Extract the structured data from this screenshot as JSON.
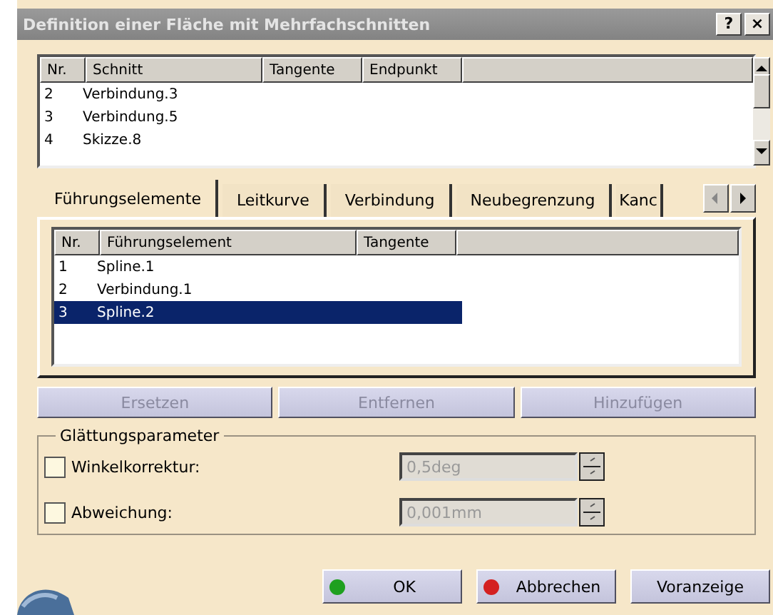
{
  "window": {
    "title": "Definition einer Fläche mit Mehrfachschnitten",
    "help": "?",
    "close": "×"
  },
  "sections": {
    "columns": [
      "Nr.",
      "Schnitt",
      "Tangente",
      "Endpunkt"
    ],
    "rows": [
      {
        "cells": [
          "2",
          "Verbindung.3"
        ],
        "selected": false
      },
      {
        "cells": [
          "3",
          "Verbindung.5"
        ],
        "selected": false
      },
      {
        "cells": [
          "4",
          "Skizze.8"
        ],
        "selected": false
      }
    ]
  },
  "tabs": [
    {
      "label": "Führungselemente",
      "selected": true
    },
    {
      "label": "Leitkurve",
      "selected": false
    },
    {
      "label": "Verbindung",
      "selected": false
    },
    {
      "label": "Neubegrenzung",
      "selected": false
    },
    {
      "label": "Kanc",
      "selected": false
    }
  ],
  "guides": {
    "columns": [
      "Nr.",
      "Führungselement",
      "Tangente"
    ],
    "rows": [
      {
        "cells": [
          "1",
          "Spline.1"
        ],
        "selected": false
      },
      {
        "cells": [
          "2",
          "Verbindung.1"
        ],
        "selected": false
      },
      {
        "cells": [
          "3",
          "Spline.2"
        ],
        "selected": true
      }
    ]
  },
  "actions": [
    {
      "label": "Ersetzen",
      "disabled": true
    },
    {
      "label": "Entfernen",
      "disabled": true
    },
    {
      "label": "Hinzufügen",
      "disabled": true
    }
  ],
  "smoothing": {
    "title": "Glättungsparameter",
    "params": [
      {
        "label": "Winkelkorrektur:",
        "checked": false,
        "value": "0,5deg",
        "disabled": true
      },
      {
        "label": "Abweichung:",
        "checked": false,
        "value": "0,001mm",
        "disabled": true
      }
    ]
  },
  "buttons": [
    {
      "label": "OK",
      "color": "#1fa01f"
    },
    {
      "label": "Abbrechen",
      "color": "#d42020"
    },
    {
      "label": "Voranzeige"
    }
  ]
}
